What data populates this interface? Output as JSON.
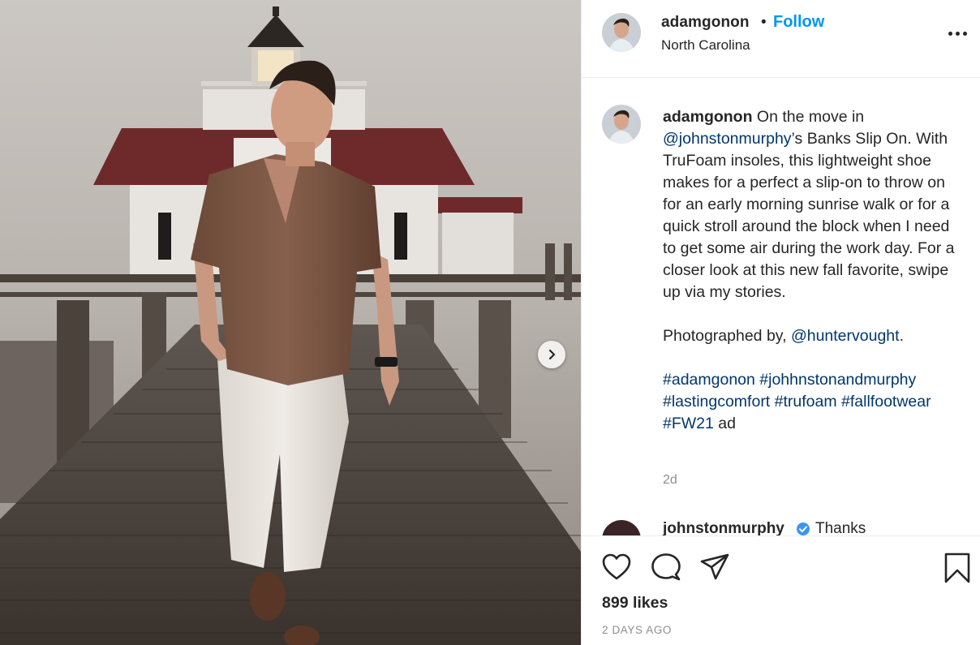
{
  "post": {
    "photo_alt": "",
    "carousel": {
      "next_icon": "chevron-right-icon"
    }
  },
  "header": {
    "username": "adamgonon",
    "separator": "•",
    "follow_label": "Follow",
    "location": "North Carolina",
    "more_icon": "more-horizontal-icon"
  },
  "caption": {
    "username": "adamgonon",
    "text_intro": " On the move in ",
    "mention_brand": "@johnstonmurphy",
    "text_body": "’s Banks Slip On. With TruFoam insoles, this lightweight shoe makes for a perfect a slip-on to throw on for an early morning sunrise walk or for a quick stroll around the block when I need to get some air during the work day. For a closer look at this new fall favorite, swipe up via my stories.",
    "photo_credit_prefix": "Photographed by, ",
    "photo_credit_mention": "@huntervought",
    "photo_credit_suffix": ".",
    "hashtags": [
      "#adamgonon",
      "#johhnstonandmurphy",
      "#lastingcomfort",
      "#trufoam",
      "#fallfootwear",
      "#FW21"
    ],
    "ad_label": " ad",
    "time_ago": "2d"
  },
  "next_comment": {
    "username": "johnstonmurphy",
    "verified_icon": "verified-badge-icon",
    "text": "Thanks"
  },
  "actions": {
    "like_icon": "heart-icon",
    "comment_icon": "comment-icon",
    "share_icon": "paper-plane-icon",
    "save_icon": "bookmark-icon",
    "likes": "899 likes",
    "date": "2 DAYS AGO"
  },
  "colors": {
    "link": "#00376b",
    "follow": "#0095f6",
    "secondary_text": "#8e8e8e",
    "divider": "#efefef"
  }
}
